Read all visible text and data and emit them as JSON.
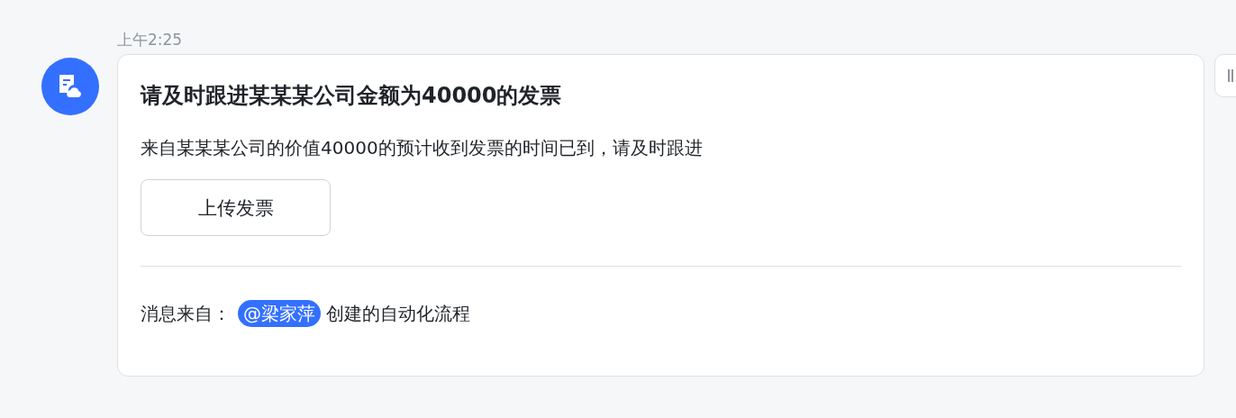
{
  "message": {
    "time": "上午2:25",
    "card": {
      "title": "请及时跟进某某某公司金额为40000的发票",
      "body": "来自某某某公司的价值40000的预计收到发票的时间已到，请及时跟进",
      "button": "上传发票",
      "footer": {
        "label": "消息来自：",
        "mention": "@梁家萍",
        "suffix": "创建的自动化流程"
      }
    }
  }
}
